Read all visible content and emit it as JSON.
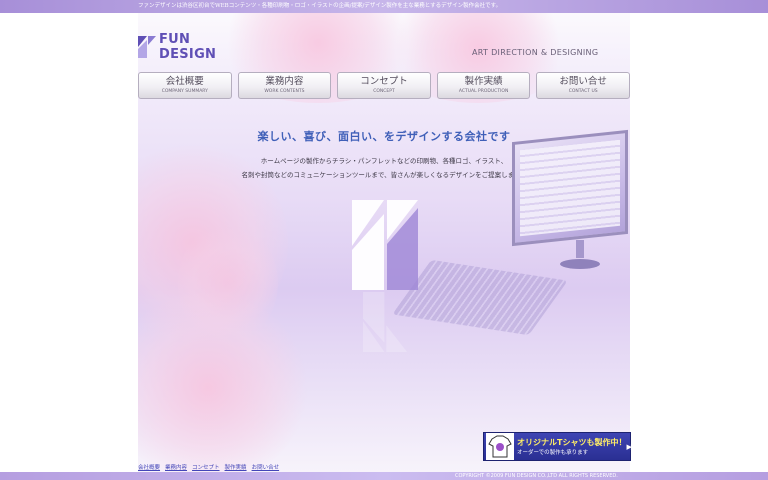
{
  "top_bar": {
    "text": "ファンデザインは渋谷区初台でWEBコンテンツ・各種印刷物・ロゴ・イラストの企画/提案/デザイン製作を主な業務とするデザイン製作会社です。"
  },
  "header": {
    "logo_text": "FUN DESIGN",
    "tagline": "ART DIRECTION & DESIGNING"
  },
  "nav": {
    "items": [
      {
        "ja": "会社概要",
        "en": "COMPANY SUMMARY"
      },
      {
        "ja": "業務内容",
        "en": "WORK CONTENTS"
      },
      {
        "ja": "コンセプト",
        "en": "CONCEPT"
      },
      {
        "ja": "製作実績",
        "en": "ACTUAL PRODUCTION"
      },
      {
        "ja": "お問い合せ",
        "en": "CONTACT US"
      }
    ]
  },
  "main": {
    "headline": "楽しい、喜び、面白い、をデザインする会社です",
    "body_line1": "ホームページの製作からチラシ・パンフレットなどの印刷物、各種ロゴ、イラスト、",
    "body_line2": "名刺や封筒などのコミュニケーションツールまで、皆さんが楽しくなるデザインをご提案します。"
  },
  "banner": {
    "title": "オリジナルTシャツも製作中！",
    "subtitle": "オーダーでの製作も承ります",
    "arrow": "▶▶"
  },
  "footer": {
    "links": [
      "会社概要",
      "業務内容",
      "コンセプト",
      "製作実績",
      "お問い合せ"
    ],
    "copyright": "COPYRIGHT ©2009 FUN DESIGN CO.,LTD ALL RIGHTS RESERVED."
  },
  "colors": {
    "accent": "#5f4fb5",
    "headline": "#3f5fb8",
    "top_bar": "#a78fd8"
  }
}
